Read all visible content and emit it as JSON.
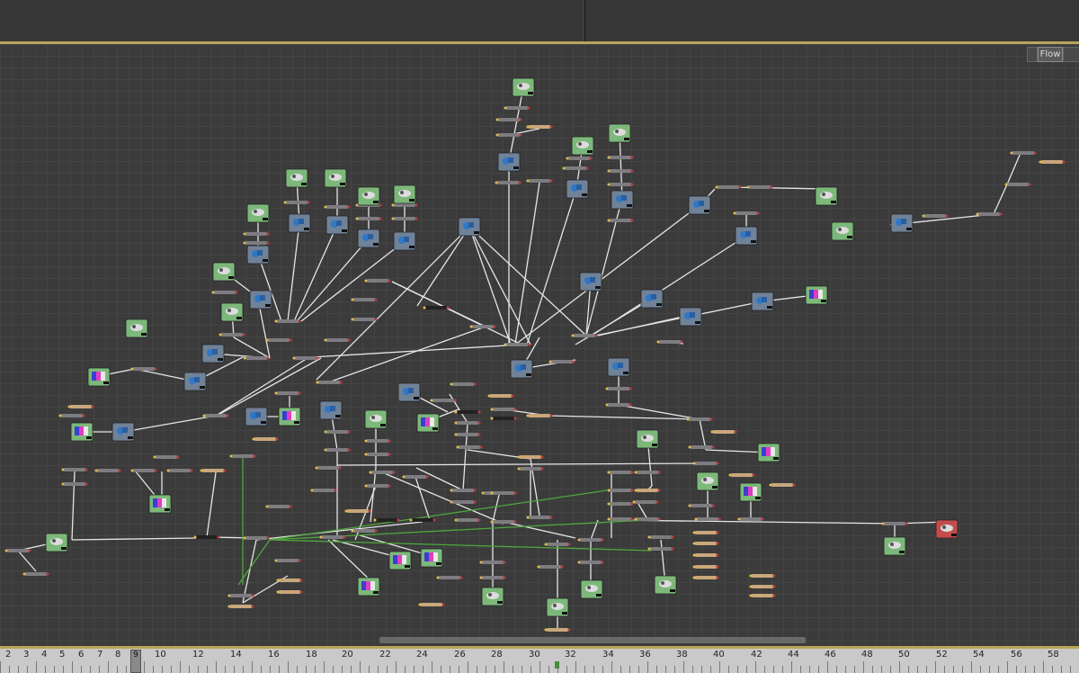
{
  "panel_tab": {
    "label": "Flow"
  },
  "timeline": {
    "current_frame": "9",
    "ticks": [
      "2",
      "3",
      "4",
      "5",
      "6",
      "7",
      "8",
      "10",
      "12",
      "14",
      "16",
      "18",
      "20",
      "22",
      "24",
      "26",
      "28",
      "30",
      "32",
      "34",
      "36",
      "38",
      "40",
      "42",
      "44",
      "46",
      "48",
      "50",
      "52",
      "54",
      "56",
      "58"
    ]
  },
  "colors": {
    "background": "#3b3b3b",
    "gold_border": "#b9a45a",
    "node_green": "#7cb87a",
    "node_blue": "#6f8298",
    "node_red": "#c44c4c",
    "connection_white": "#e6e6e6",
    "connection_green": "#4fa83d"
  }
}
